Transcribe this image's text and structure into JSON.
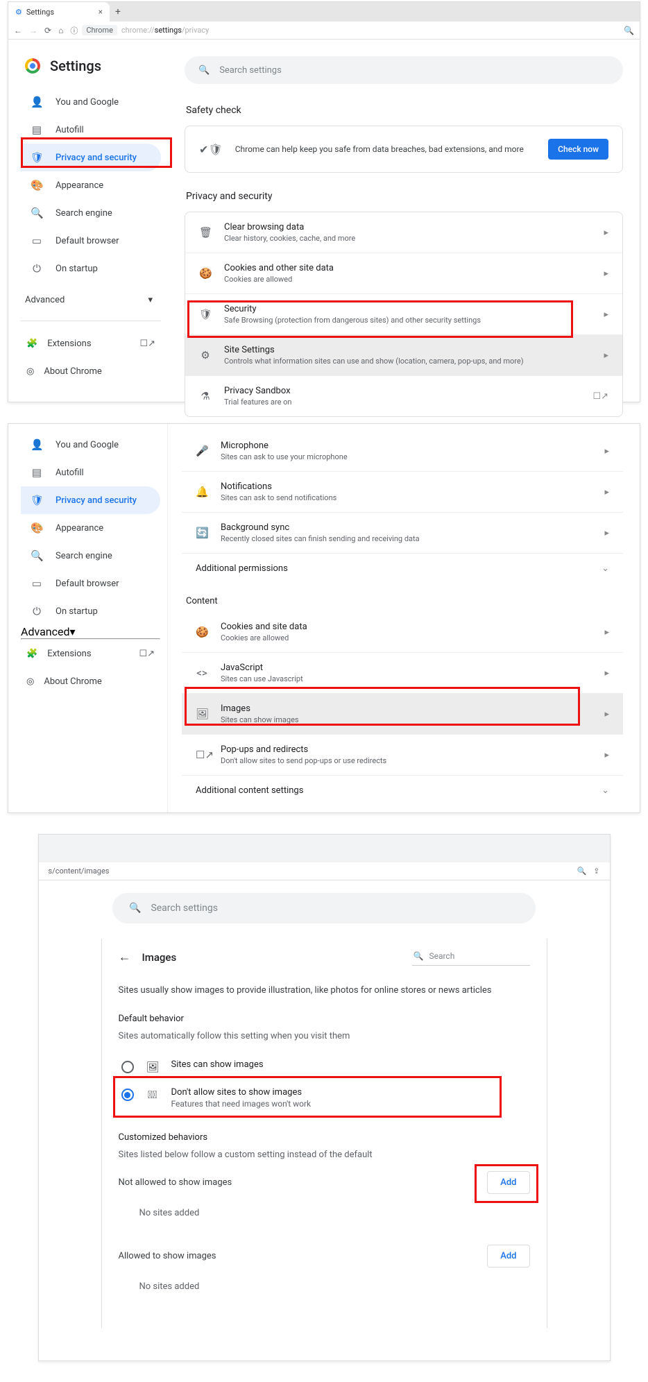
{
  "p1": {
    "tab_title": "Settings",
    "url_chip": "Chrome",
    "url": "chrome://settings/privacy",
    "brand": "Settings",
    "search_placeholder": "Search settings",
    "nav": [
      "You and Google",
      "Autofill",
      "Privacy and security",
      "Appearance",
      "Search engine",
      "Default browser",
      "On startup"
    ],
    "advanced": "Advanced",
    "extensions": "Extensions",
    "about": "About Chrome",
    "safety_title": "Safety check",
    "safety_text": "Chrome can help keep you safe from data breaches, bad extensions, and more",
    "check_now": "Check now",
    "ps_title": "Privacy and security",
    "rows": [
      {
        "t": "Clear browsing data",
        "s": "Clear history, cookies, cache, and more"
      },
      {
        "t": "Cookies and other site data",
        "s": "Cookies are allowed"
      },
      {
        "t": "Security",
        "s": "Safe Browsing (protection from dangerous sites) and other security settings"
      },
      {
        "t": "Site Settings",
        "s": "Controls what information sites can use and show (location, camera, pop-ups, and more)"
      },
      {
        "t": "Privacy Sandbox",
        "s": "Trial features are on"
      }
    ]
  },
  "p2": {
    "nav": [
      "You and Google",
      "Autofill",
      "Privacy and security",
      "Appearance",
      "Search engine",
      "Default browser",
      "On startup"
    ],
    "advanced": "Advanced",
    "extensions": "Extensions",
    "about": "About Chrome",
    "perm_rows": [
      {
        "t": "Microphone",
        "s": "Sites can ask to use your microphone"
      },
      {
        "t": "Notifications",
        "s": "Sites can ask to send notifications"
      },
      {
        "t": "Background sync",
        "s": "Recently closed sites can finish sending and receiving data"
      }
    ],
    "add_perm": "Additional permissions",
    "content_head": "Content",
    "content_rows": [
      {
        "t": "Cookies and site data",
        "s": "Cookies are allowed"
      },
      {
        "t": "JavaScript",
        "s": "Sites can use Javascript"
      },
      {
        "t": "Images",
        "s": "Sites can show images"
      },
      {
        "t": "Pop-ups and redirects",
        "s": "Don't allow sites to send pop-ups or use redirects"
      }
    ],
    "add_content": "Additional content settings"
  },
  "p3": {
    "url": "s/content/images",
    "search_placeholder": "Search settings",
    "title": "Images",
    "search_label": "Search",
    "desc": "Sites usually show images to provide illustration, like photos for online stores or news articles",
    "default_label": "Default behavior",
    "default_hint": "Sites automatically follow this setting when you visit them",
    "opt1": "Sites can show images",
    "opt2_t": "Don't allow sites to show images",
    "opt2_s": "Features that need images won't work",
    "custom_label": "Customized behaviors",
    "custom_hint": "Sites listed below follow a custom setting instead of the default",
    "not_allowed": "Not allowed to show images",
    "allowed": "Allowed to show images",
    "add": "Add",
    "no_sites": "No sites added"
  }
}
